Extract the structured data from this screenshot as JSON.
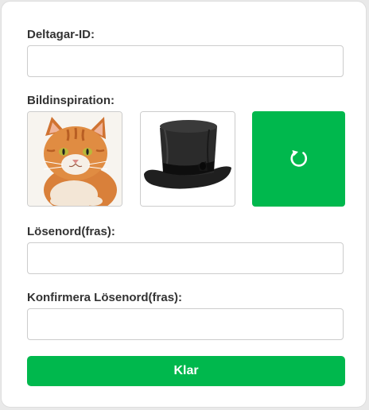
{
  "colors": {
    "accent": "#00b84d",
    "label_text": "#333333"
  },
  "form": {
    "participant_id": {
      "label": "Deltagar-ID:",
      "value": "",
      "placeholder": ""
    },
    "image_inspiration": {
      "label": "Bildinspiration:",
      "images": [
        {
          "icon": "cat-image",
          "alt": "katt"
        },
        {
          "icon": "top-hat-image",
          "alt": "hög hatt"
        }
      ],
      "refresh_icon": "refresh-icon"
    },
    "password": {
      "label": "Lösenord(fras):",
      "value": "",
      "placeholder": ""
    },
    "confirm_password": {
      "label": "Konfirmera Lösenord(fras):",
      "value": "",
      "placeholder": ""
    },
    "submit_label": "Klar"
  }
}
